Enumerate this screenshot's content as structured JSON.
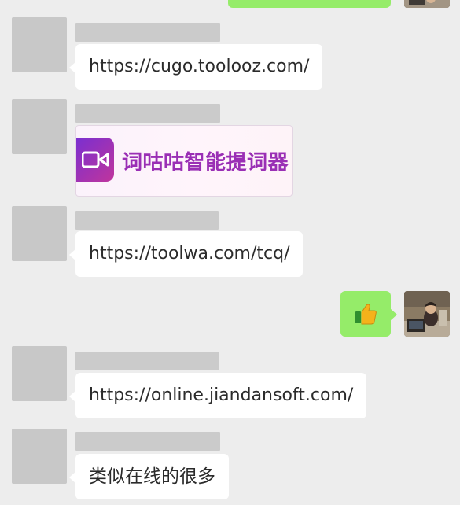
{
  "messages": [
    {
      "type": "link",
      "text": "https://cugo.toolooz.com/"
    },
    {
      "type": "card",
      "title": "词咕咕智能提词器"
    },
    {
      "type": "link",
      "text": "https://toolwa.com/tcq/"
    },
    {
      "type": "emoji",
      "icon": "thumbs-up-emoji"
    },
    {
      "type": "link",
      "text": "https://online.jiandansoft.com/"
    },
    {
      "type": "text",
      "text": "类似在线的很多"
    }
  ],
  "colors": {
    "background": "#ededed",
    "sent_bubble": "#95ec69",
    "received_bubble": "#ffffff",
    "card_title": "#9a2fb5"
  }
}
